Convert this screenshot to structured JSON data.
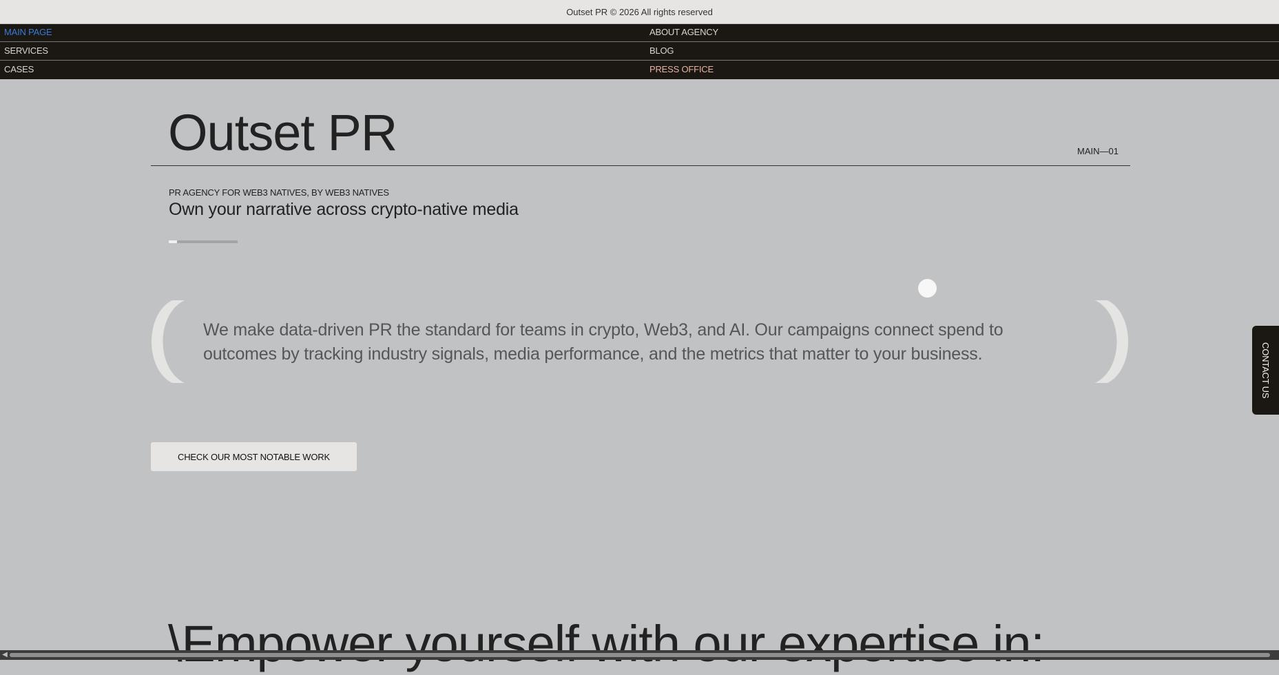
{
  "footer": {
    "copyright": "Outset PR © 2026 All rights reserved"
  },
  "nav": {
    "items": [
      {
        "label": "MAIN PAGE"
      },
      {
        "label": "ABOUT AGENCY"
      },
      {
        "label": "SERVICES"
      },
      {
        "label": "BLOG"
      },
      {
        "label": "CASES"
      },
      {
        "label": "PRESS OFFICE"
      }
    ],
    "active_color": "#3a7bd5",
    "press_color": "#e6b3a3"
  },
  "hero": {
    "title": "Outset PR",
    "section_code": "MAIN—01",
    "tagline": "PR AGENCY FOR WEB3 NATIVES, BY WEB3 NATIVES",
    "subtitle": "Own your narrative across crypto-native media",
    "slide_progress": 0.12
  },
  "statement": {
    "text": "We make data-driven PR the standard for teams in crypto, Web3, and AI. Our campaigns connect spend to outcomes by tracking industry signals, media performance, and the metrics that matter to your business."
  },
  "cta": {
    "label": "CHECK OUR MOST NOTABLE WORK"
  },
  "contact_tab": {
    "label": "CONTACT US"
  },
  "expertise": {
    "heading": "\\Empower yourself with our expertise in:"
  },
  "icons": {
    "scroll_left": "chevron-left-icon"
  },
  "colors": {
    "background": "#c1c2c4",
    "nav_background": "#1b1713",
    "top_bar": "#e6e5e3"
  }
}
